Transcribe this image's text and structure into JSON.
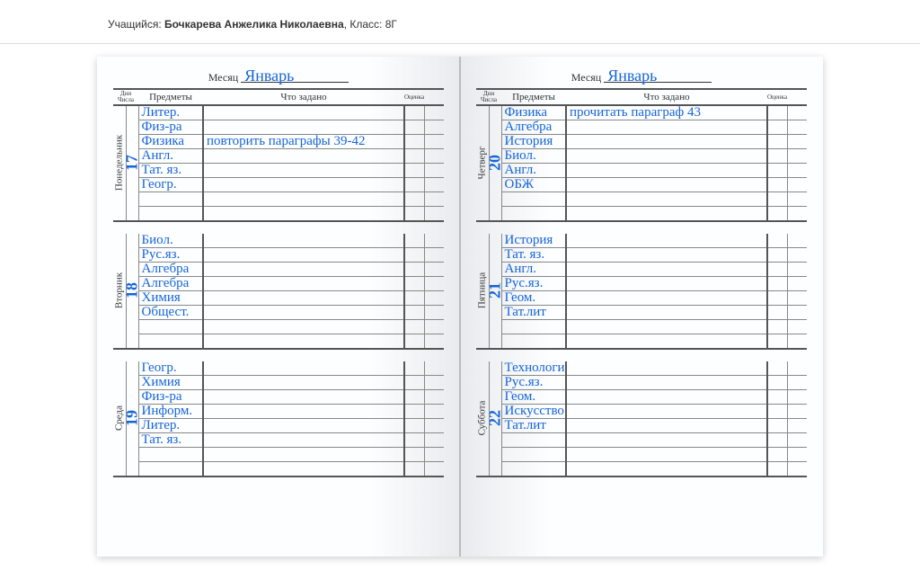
{
  "header": {
    "student_label": "Учащийся:",
    "student_name": "Бочкарева Анжелика Николаевна",
    "class_label": "Класс:",
    "class_value": "8Г"
  },
  "month_label": "Месяц",
  "month_value": "Январь",
  "columns": {
    "dow_date": "Дни\nЧисла",
    "subject": "Предметы",
    "homework": "Что задано",
    "grade": "Оценка"
  },
  "left_page": [
    {
      "dow": "Понедельник",
      "date": "17",
      "rows": [
        {
          "s": "Литер.",
          "h": ""
        },
        {
          "s": "Физ-ра",
          "h": ""
        },
        {
          "s": "Физика",
          "h": "повторить параграфы 39-42"
        },
        {
          "s": "Англ.",
          "h": ""
        },
        {
          "s": "Тат. яз.",
          "h": ""
        },
        {
          "s": "Геогр.",
          "h": ""
        },
        {
          "s": "",
          "h": ""
        },
        {
          "s": "",
          "h": ""
        }
      ]
    },
    {
      "dow": "Вторник",
      "date": "18",
      "rows": [
        {
          "s": "Биол.",
          "h": ""
        },
        {
          "s": "Рус.яз.",
          "h": ""
        },
        {
          "s": "Алгебра",
          "h": ""
        },
        {
          "s": "Алгебра",
          "h": ""
        },
        {
          "s": "Химия",
          "h": ""
        },
        {
          "s": "Общест.",
          "h": ""
        },
        {
          "s": "",
          "h": ""
        },
        {
          "s": "",
          "h": ""
        }
      ]
    },
    {
      "dow": "Среда",
      "date": "19",
      "rows": [
        {
          "s": "Геогр.",
          "h": ""
        },
        {
          "s": "Химия",
          "h": ""
        },
        {
          "s": "Физ-ра",
          "h": ""
        },
        {
          "s": "Информ.",
          "h": ""
        },
        {
          "s": "Литер.",
          "h": ""
        },
        {
          "s": "Тат. яз.",
          "h": ""
        },
        {
          "s": "",
          "h": ""
        },
        {
          "s": "",
          "h": ""
        }
      ]
    }
  ],
  "right_page": [
    {
      "dow": "Четверг",
      "date": "20",
      "rows": [
        {
          "s": "Физика",
          "h": "прочитать параграф 43"
        },
        {
          "s": "Алгебра",
          "h": ""
        },
        {
          "s": "История",
          "h": ""
        },
        {
          "s": "Биол.",
          "h": ""
        },
        {
          "s": "Англ.",
          "h": ""
        },
        {
          "s": "ОБЖ",
          "h": ""
        },
        {
          "s": "",
          "h": ""
        },
        {
          "s": "",
          "h": ""
        }
      ]
    },
    {
      "dow": "Пятница",
      "date": "21",
      "rows": [
        {
          "s": "История",
          "h": ""
        },
        {
          "s": "Тат. яз.",
          "h": ""
        },
        {
          "s": "Англ.",
          "h": ""
        },
        {
          "s": "Рус.яз.",
          "h": ""
        },
        {
          "s": "Геом.",
          "h": ""
        },
        {
          "s": "Тат.лит",
          "h": ""
        },
        {
          "s": "",
          "h": ""
        },
        {
          "s": "",
          "h": ""
        }
      ]
    },
    {
      "dow": "Суббота",
      "date": "22",
      "rows": [
        {
          "s": "Технологи",
          "h": ""
        },
        {
          "s": "Рус.яз.",
          "h": ""
        },
        {
          "s": "Геом.",
          "h": ""
        },
        {
          "s": "Искусство",
          "h": ""
        },
        {
          "s": "Тат.лит",
          "h": ""
        },
        {
          "s": "",
          "h": ""
        },
        {
          "s": "",
          "h": ""
        },
        {
          "s": "",
          "h": ""
        }
      ]
    }
  ]
}
